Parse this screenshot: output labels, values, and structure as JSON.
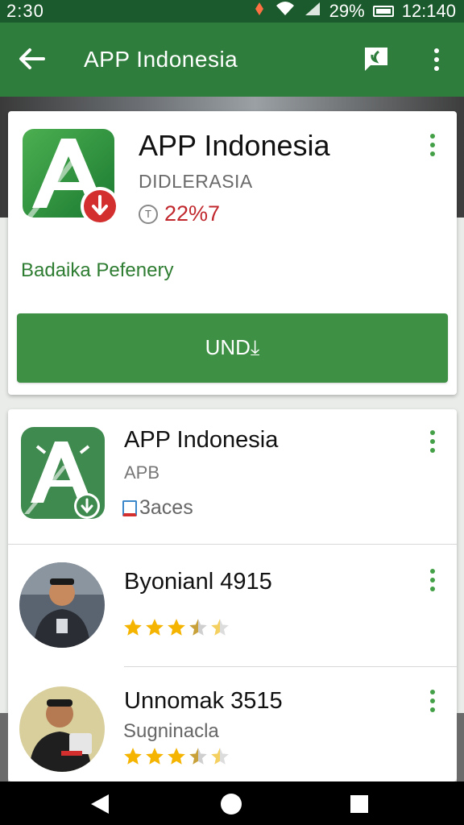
{
  "status_bar": {
    "time": "2:30",
    "battery": "29%",
    "clock": "12:140"
  },
  "app_bar": {
    "title": "APP Indonesia"
  },
  "hero": {
    "app_name": "APP Indonesia",
    "developer": "DIDLERASIA",
    "rating_icon": "T",
    "rating_value": "22%7",
    "subtitle": "Badaika Pefenery",
    "install_label": "UND⤓"
  },
  "list": [
    {
      "title": "APP Indonesia",
      "sub": "APB",
      "meta": "3aces"
    },
    {
      "title": "Byonianl 4915",
      "stars": 3.5
    },
    {
      "title": "Unnomak 3515",
      "sub": "Sugninacla",
      "stars": 3.5
    }
  ],
  "colors": {
    "primary": "#2e7d3c",
    "status": "#1b5a2c",
    "accent": "#43a047",
    "rating": "#c0282d",
    "star": "#f4b400"
  },
  "icons": [
    "back-arrow-icon",
    "feedback-icon",
    "overflow-menu-icon",
    "download-badge-icon",
    "calendar-icon",
    "star-icon",
    "nav-back-icon",
    "nav-home-icon",
    "nav-recent-icon"
  ]
}
